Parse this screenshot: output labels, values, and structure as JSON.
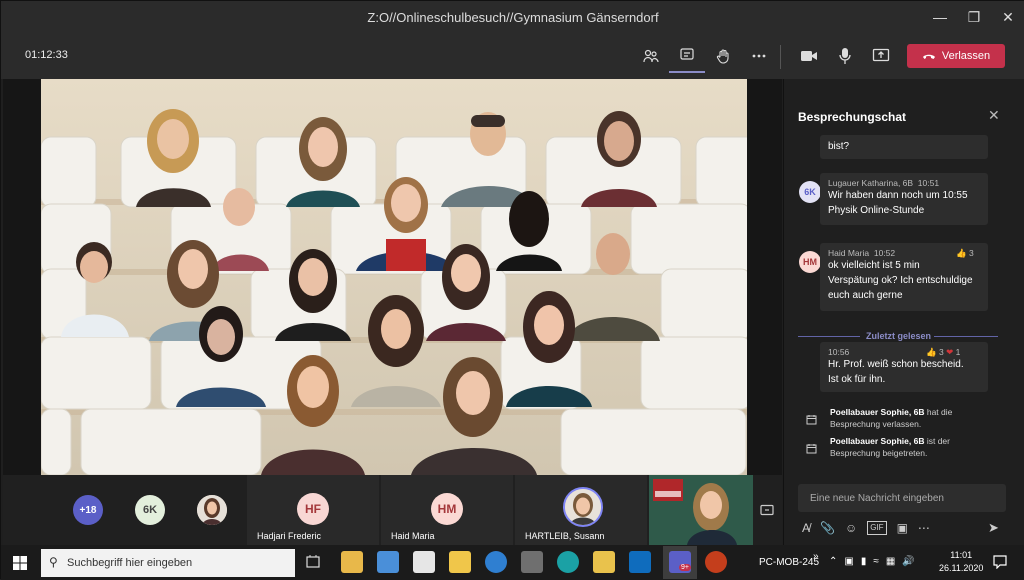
{
  "window": {
    "title": "Z:O//Onlineschulbesuch//Gymnasium Gänserndorf",
    "minimize_icon": "minimize-icon",
    "restore_icon": "restore-icon",
    "close_icon": "close-icon"
  },
  "meeting": {
    "timer": "01:12:33",
    "leave_label": "Verlassen",
    "accent": "#c4314b"
  },
  "participants_strip": {
    "overflow_count": "+18",
    "avatar_6k": "6K",
    "tiles": [
      {
        "initials": "HF",
        "name": "Hadjari Frederic"
      },
      {
        "initials": "HM",
        "name": "Haid Maria"
      },
      {
        "initials": "",
        "name": "HARTLEIB, Susann"
      }
    ]
  },
  "chat": {
    "title": "Besprechungschat",
    "partial_message": "bist?",
    "messages": [
      {
        "initials": "6K",
        "sender": "Lugauer Katharina, 6B",
        "time": "10:51",
        "lines": [
          "Wir haben dann noch um 10:55",
          "Physik Online-Stunde"
        ]
      },
      {
        "initials": "HM",
        "sender": "Haid Maria",
        "time": "10:52",
        "reaction_like_count": "3",
        "lines": [
          "ok vielleicht ist 5 min",
          "Verspätung ok? Ich entschuldige",
          "euch auch gerne"
        ]
      }
    ],
    "last_read_label": "Zuletzt gelesen",
    "own_message": {
      "time": "10:56",
      "like_count": "3",
      "heart_count": "1",
      "lines": [
        "Hr. Prof. weiß schon bescheid.",
        "Ist ok für ihn."
      ]
    },
    "system_events": [
      {
        "who": "Poellabauer Sophie, 6B",
        "text_a": " hat die",
        "text_b": "Besprechung verlassen."
      },
      {
        "who": "Poellabauer Sophie, 6B",
        "text_a": " ist der",
        "text_b": "Besprechung beigetreten."
      }
    ],
    "input_placeholder": "Eine neue Nachricht eingeben"
  },
  "taskbar": {
    "search_placeholder": "Suchbegriff hier eingeben",
    "device_name": "PC-MOB-245",
    "time": "11:01",
    "date": "26.11.2020",
    "teams_badge": "9+"
  }
}
